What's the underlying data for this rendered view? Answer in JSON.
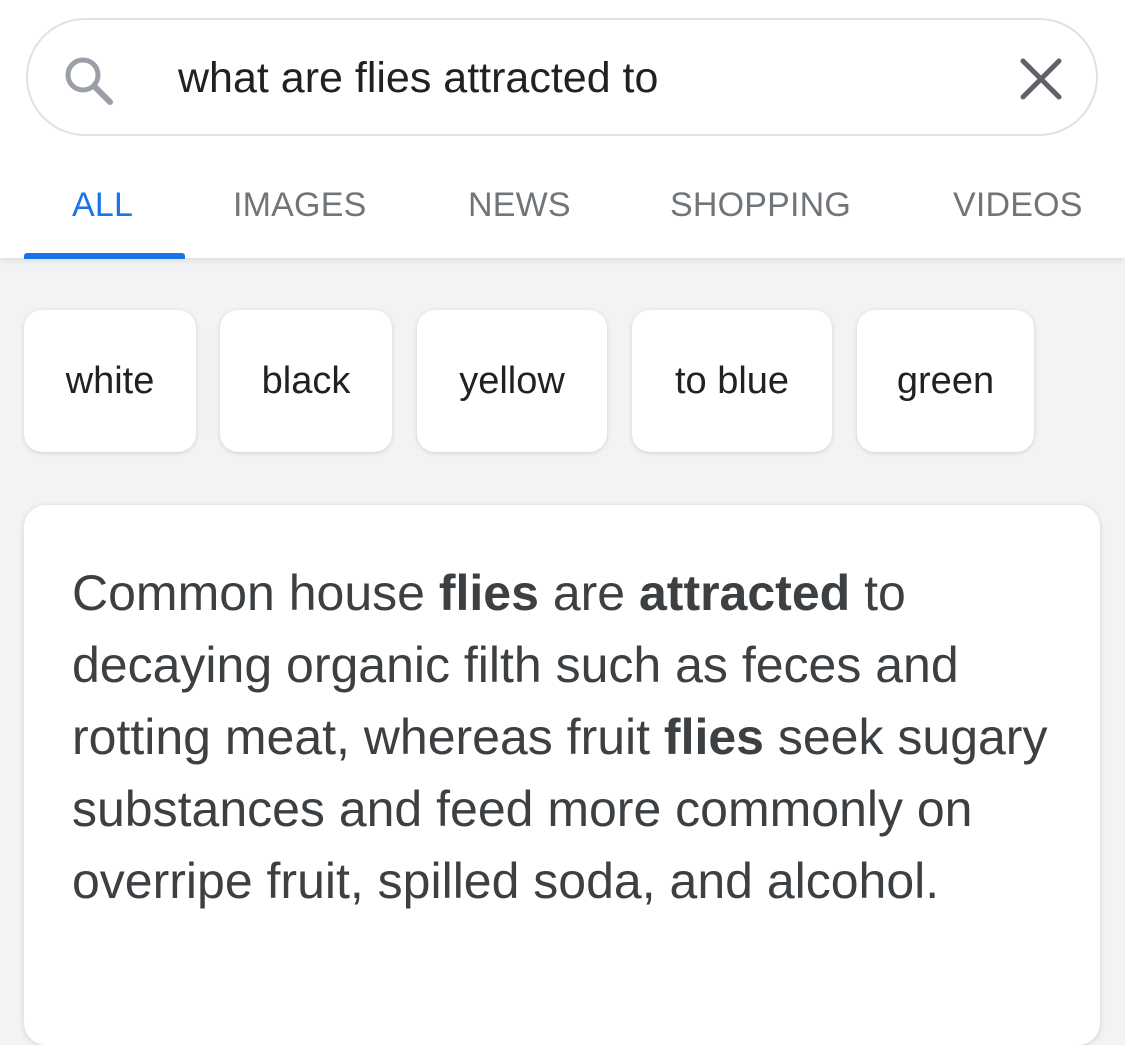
{
  "search": {
    "query": "what are flies attracted to",
    "icon": "search-icon",
    "clear_icon": "close-icon"
  },
  "tabs": [
    {
      "label": "ALL",
      "active": true
    },
    {
      "label": "IMAGES",
      "active": false
    },
    {
      "label": "NEWS",
      "active": false
    },
    {
      "label": "SHOPPING",
      "active": false
    },
    {
      "label": "VIDEOS",
      "active": false
    }
  ],
  "chips": [
    {
      "label": "white"
    },
    {
      "label": "black"
    },
    {
      "label": "yellow"
    },
    {
      "label": "to blue"
    },
    {
      "label": "green"
    }
  ],
  "answer": {
    "parts": [
      {
        "text": "Common house "
      },
      {
        "text": "flies",
        "bold": true
      },
      {
        "text": " are "
      },
      {
        "text": "attracted",
        "bold": true
      },
      {
        "text": " to decaying organic filth such as feces and rotting meat, whereas fruit "
      },
      {
        "text": "flies",
        "bold": true
      },
      {
        "text": " seek sugary substances and feed more commonly on overripe fruit, spilled soda, and alcohol."
      }
    ]
  },
  "colors": {
    "accent": "#1a73e8",
    "text": "#202124",
    "muted": "#70757a",
    "background": "#f1f3f4"
  }
}
